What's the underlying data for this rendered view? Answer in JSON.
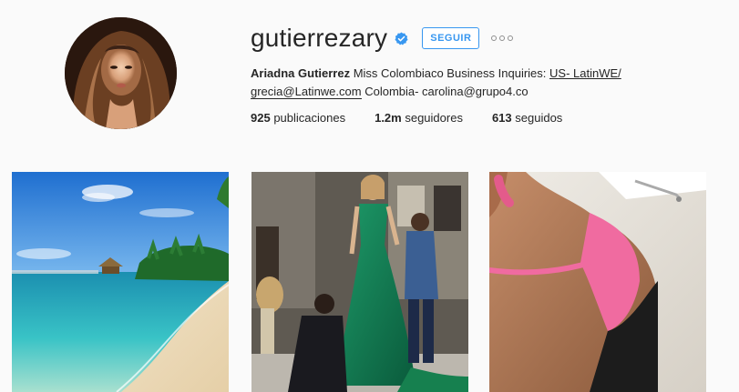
{
  "profile": {
    "username": "gutierrezary",
    "follow_label": "SEGUIR",
    "bio": {
      "name": "Ariadna Gutierrez",
      "text1": " Miss Colombiaco Business Inquiries: ",
      "link1": "US- LatinWE/",
      "link2": "grecia@Latinwe.com",
      "text2": " Colombia- carolina@grupo4.co"
    },
    "stats": {
      "posts_count": "925",
      "posts_label": " publicaciones",
      "followers_count": "1.2m",
      "followers_label": " seguidores",
      "following_count": "613",
      "following_label": " seguidos"
    }
  },
  "colors": {
    "accent": "#3897f0",
    "background": "#fafafa",
    "text": "#262626"
  },
  "posts": [
    {
      "subject": "tropical-beach-photo"
    },
    {
      "subject": "green-gown-fitting-photo"
    },
    {
      "subject": "pink-sports-bra-selfie-photo"
    }
  ]
}
